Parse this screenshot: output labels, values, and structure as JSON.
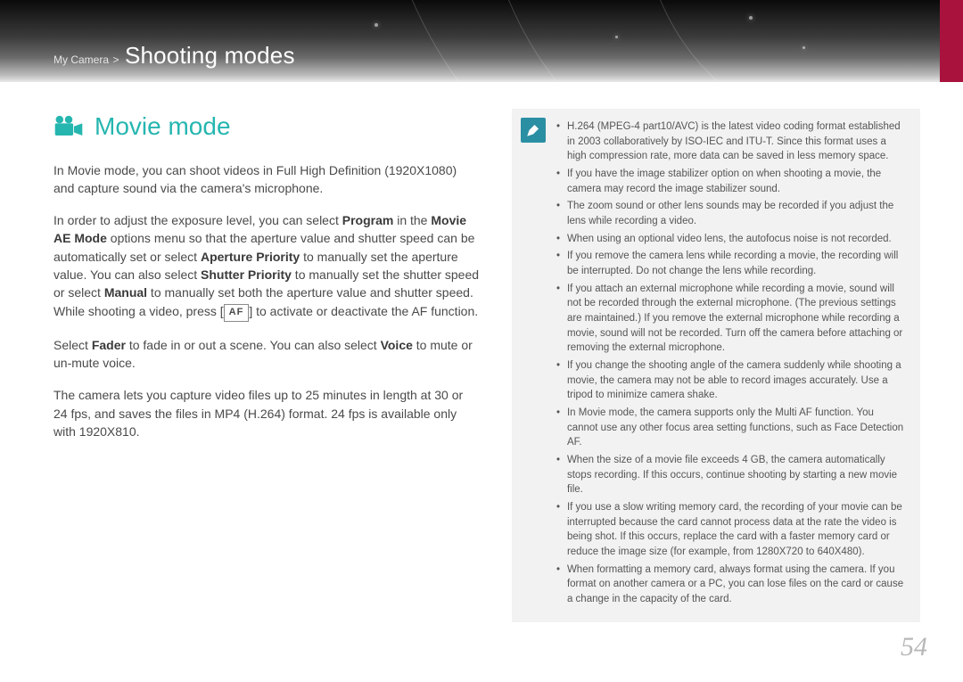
{
  "header": {
    "breadcrumb_section": "My Camera",
    "breadcrumb_separator": ">",
    "breadcrumb_title": "Shooting modes"
  },
  "page_number": "54",
  "heading": {
    "icon": "movie-camera-icon",
    "title": "Movie mode"
  },
  "body": {
    "p1": "In Movie mode, you can shoot videos in Full High Definition (1920X1080) and capture sound via the camera's microphone.",
    "p2_1": "In order to adjust the exposure level, you can select ",
    "p2_b1": "Program",
    "p2_2": " in the ",
    "p2_b2": "Movie AE Mode",
    "p2_3": " options menu so that the aperture value and shutter speed can be automatically set or select ",
    "p2_b3": "Aperture Priority",
    "p2_4": " to manually set the aperture value. You can also select ",
    "p2_b4": "Shutter Priority",
    "p2_5": " to manually set the shutter speed or select ",
    "p2_b5": "Manual",
    "p2_6": " to manually set both the aperture value and shutter speed. While shooting a video, press [",
    "p2_af": "AF",
    "p2_7": "] to activate or deactivate the AF function.",
    "p3_1": "Select ",
    "p3_b1": "Fader",
    "p3_2": " to fade in or out a scene. You can also select ",
    "p3_b2": "Voice",
    "p3_3": " to mute or un-mute voice.",
    "p4": "The camera lets you capture video files up to 25 minutes in length at 30 or 24 fps, and saves the files in MP4 (H.264) format. 24 fps is available only with 1920X810."
  },
  "notes": [
    "H.264 (MPEG-4 part10/AVC) is the latest video coding format established in 2003 collaboratively by ISO-IEC and ITU-T. Since this format uses a high compression rate, more data can be saved in less memory space.",
    "If you have the image stabilizer option on when shooting a movie, the camera may record the image stabilizer sound.",
    "The zoom sound or other lens sounds may be recorded if you adjust the lens while recording a video.",
    "When using an optional video lens, the autofocus noise is not recorded.",
    "If you remove the camera lens while recording a movie, the recording will be interrupted. Do not change the lens while recording.",
    "If you attach an external microphone while recording a movie, sound will not be recorded through the external microphone. (The previous settings are maintained.) If you remove the external microphone while recording a movie, sound will not be recorded. Turn off the camera before attaching or removing the external microphone.",
    "If you change the shooting angle of the camera suddenly while shooting a movie, the camera may not be able to record images accurately. Use a tripod to minimize camera shake.",
    "In Movie mode, the camera supports only the Multi AF function. You cannot use any other focus area setting functions, such as Face Detection AF.",
    "When the size of a movie file exceeds 4 GB, the camera automatically stops recording. If this occurs, continue shooting by starting a new movie file.",
    "If you use a slow writing memory card, the recording of your movie can be interrupted because the card cannot process data at the rate the video is being shot. If this occurs, replace the card with a faster memory card or reduce the image size (for example, from 1280X720 to 640X480).",
    "When formatting a memory card, always format using the camera. If you format on another camera or a PC, you can lose files on the card or cause a change in the capacity of the card."
  ]
}
